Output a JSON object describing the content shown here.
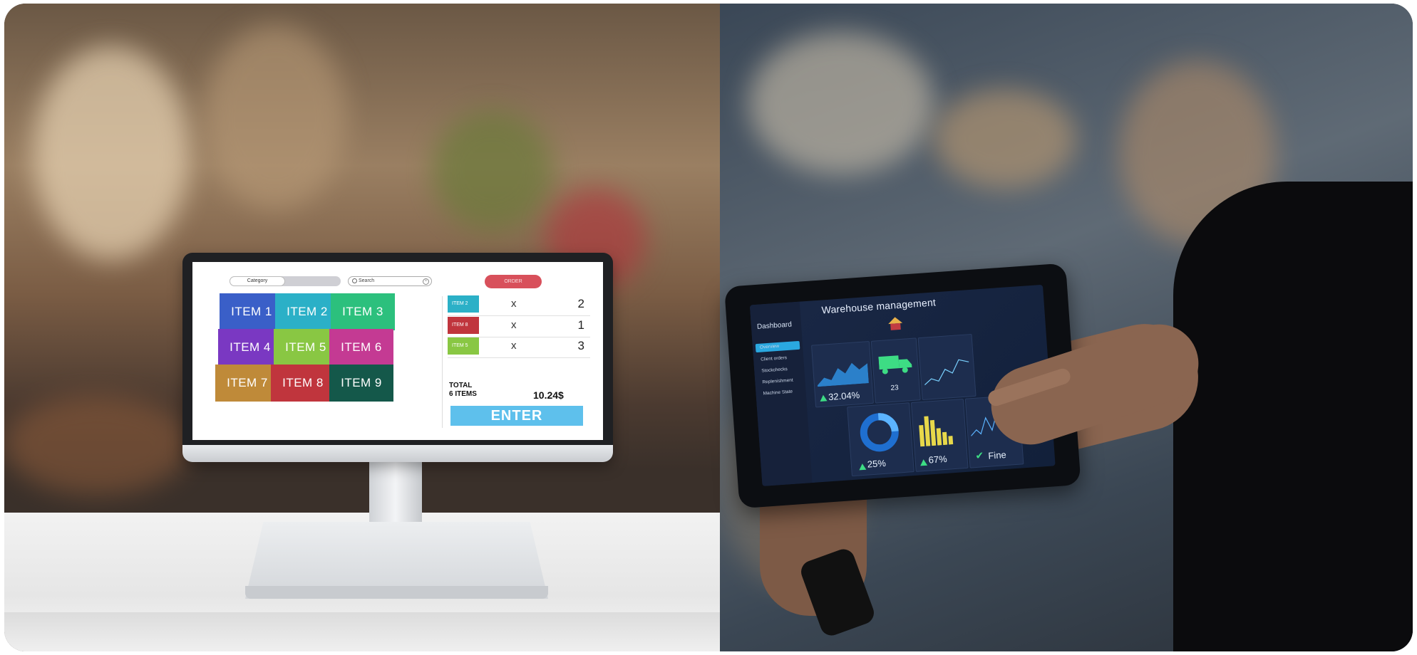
{
  "pos": {
    "segment_active": "Category",
    "search_placeholder": "Search",
    "top_button": "ORDER",
    "tiles": [
      {
        "label": "ITEM 1",
        "color": "#3a5fc8"
      },
      {
        "label": "ITEM 2",
        "color": "#2bb0c7"
      },
      {
        "label": "ITEM 3",
        "color": "#2cc07d"
      },
      {
        "label": "ITEM 4",
        "color": "#7a38c2"
      },
      {
        "label": "ITEM 5",
        "color": "#89c743"
      },
      {
        "label": "ITEM 6",
        "color": "#c43a93"
      },
      {
        "label": "ITEM 7",
        "color": "#bf8a39"
      },
      {
        "label": "ITEM 8",
        "color": "#c0353d"
      },
      {
        "label": "ITEM 9",
        "color": "#14584a"
      }
    ],
    "order": [
      {
        "tag": "ITEM 2",
        "color": "#2bb0c7",
        "x": "x",
        "qty": "2"
      },
      {
        "tag": "ITEM 8",
        "color": "#c0353d",
        "x": "x",
        "qty": "1"
      },
      {
        "tag": "ITEM 5",
        "color": "#89c743",
        "x": "x",
        "qty": "3"
      }
    ],
    "total_label": "TOTAL",
    "items_count": "6 ITEMS",
    "total_amount": "10.24$",
    "enter_label": "ENTER"
  },
  "tablet": {
    "title": "Warehouse management",
    "sidebar_title": "Dashboard",
    "sidebar_items": [
      "Overview",
      "Client orders",
      "Stockchecks",
      "Replenishment",
      "Machine State"
    ],
    "metrics": {
      "growth": "32.04%",
      "trucks": "23",
      "donut": "25%",
      "bars": "67%",
      "status": "Fine"
    }
  }
}
